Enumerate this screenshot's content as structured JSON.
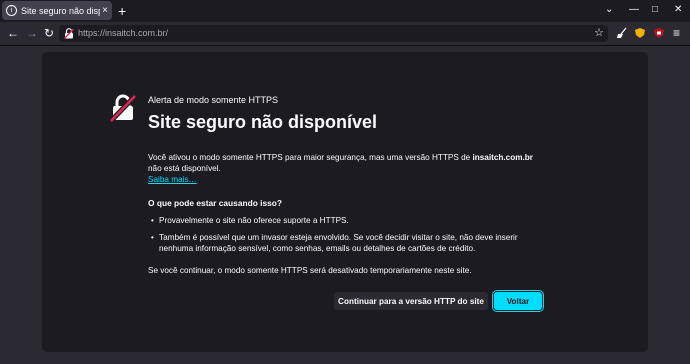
{
  "tab": {
    "title": "Site seguro não disponível",
    "close": "×"
  },
  "toolbar": {
    "new_tab": "+",
    "minimize": "—",
    "maximize": "□",
    "close": "✕"
  },
  "nav": {
    "back": "←",
    "forward": "→",
    "reload": "↻",
    "url": "https://insaitch.com.br/",
    "bookmark": "☆",
    "menu": "≡"
  },
  "extensions": [
    "broom-extension-icon",
    "shield-extension-icon",
    "ublock-extension-icon"
  ],
  "page": {
    "alert_label": "Alerta de modo somente HTTPS",
    "title": "Site seguro não disponível",
    "description_before": "Você ativou o modo somente HTTPS para maior segurança, mas uma versão HTTPS de ",
    "domain": "insaitch.com.br",
    "description_after": " não está disponível.",
    "learn_more": "Saiba mais…",
    "cause_title": "O que pode estar causando isso?",
    "causes": [
      "Provavelmente o site não oferece suporte a HTTPS.",
      "Também é possível que um invasor esteja envolvido. Se você decidir visitar o site, não deve inserir nenhuma informação sensível, como senhas, emails ou detalhes de cartões de crédito."
    ],
    "footnote": "Se você continuar, o modo somente HTTPS será desativado temporariamente neste site.",
    "continue_button": "Continuar para a versão HTTP do site",
    "back_button": "Voltar"
  },
  "colors": {
    "accent": "#00ddff",
    "card": "#1c1b22",
    "background": "#2b2a33",
    "warning": "#e22850"
  }
}
